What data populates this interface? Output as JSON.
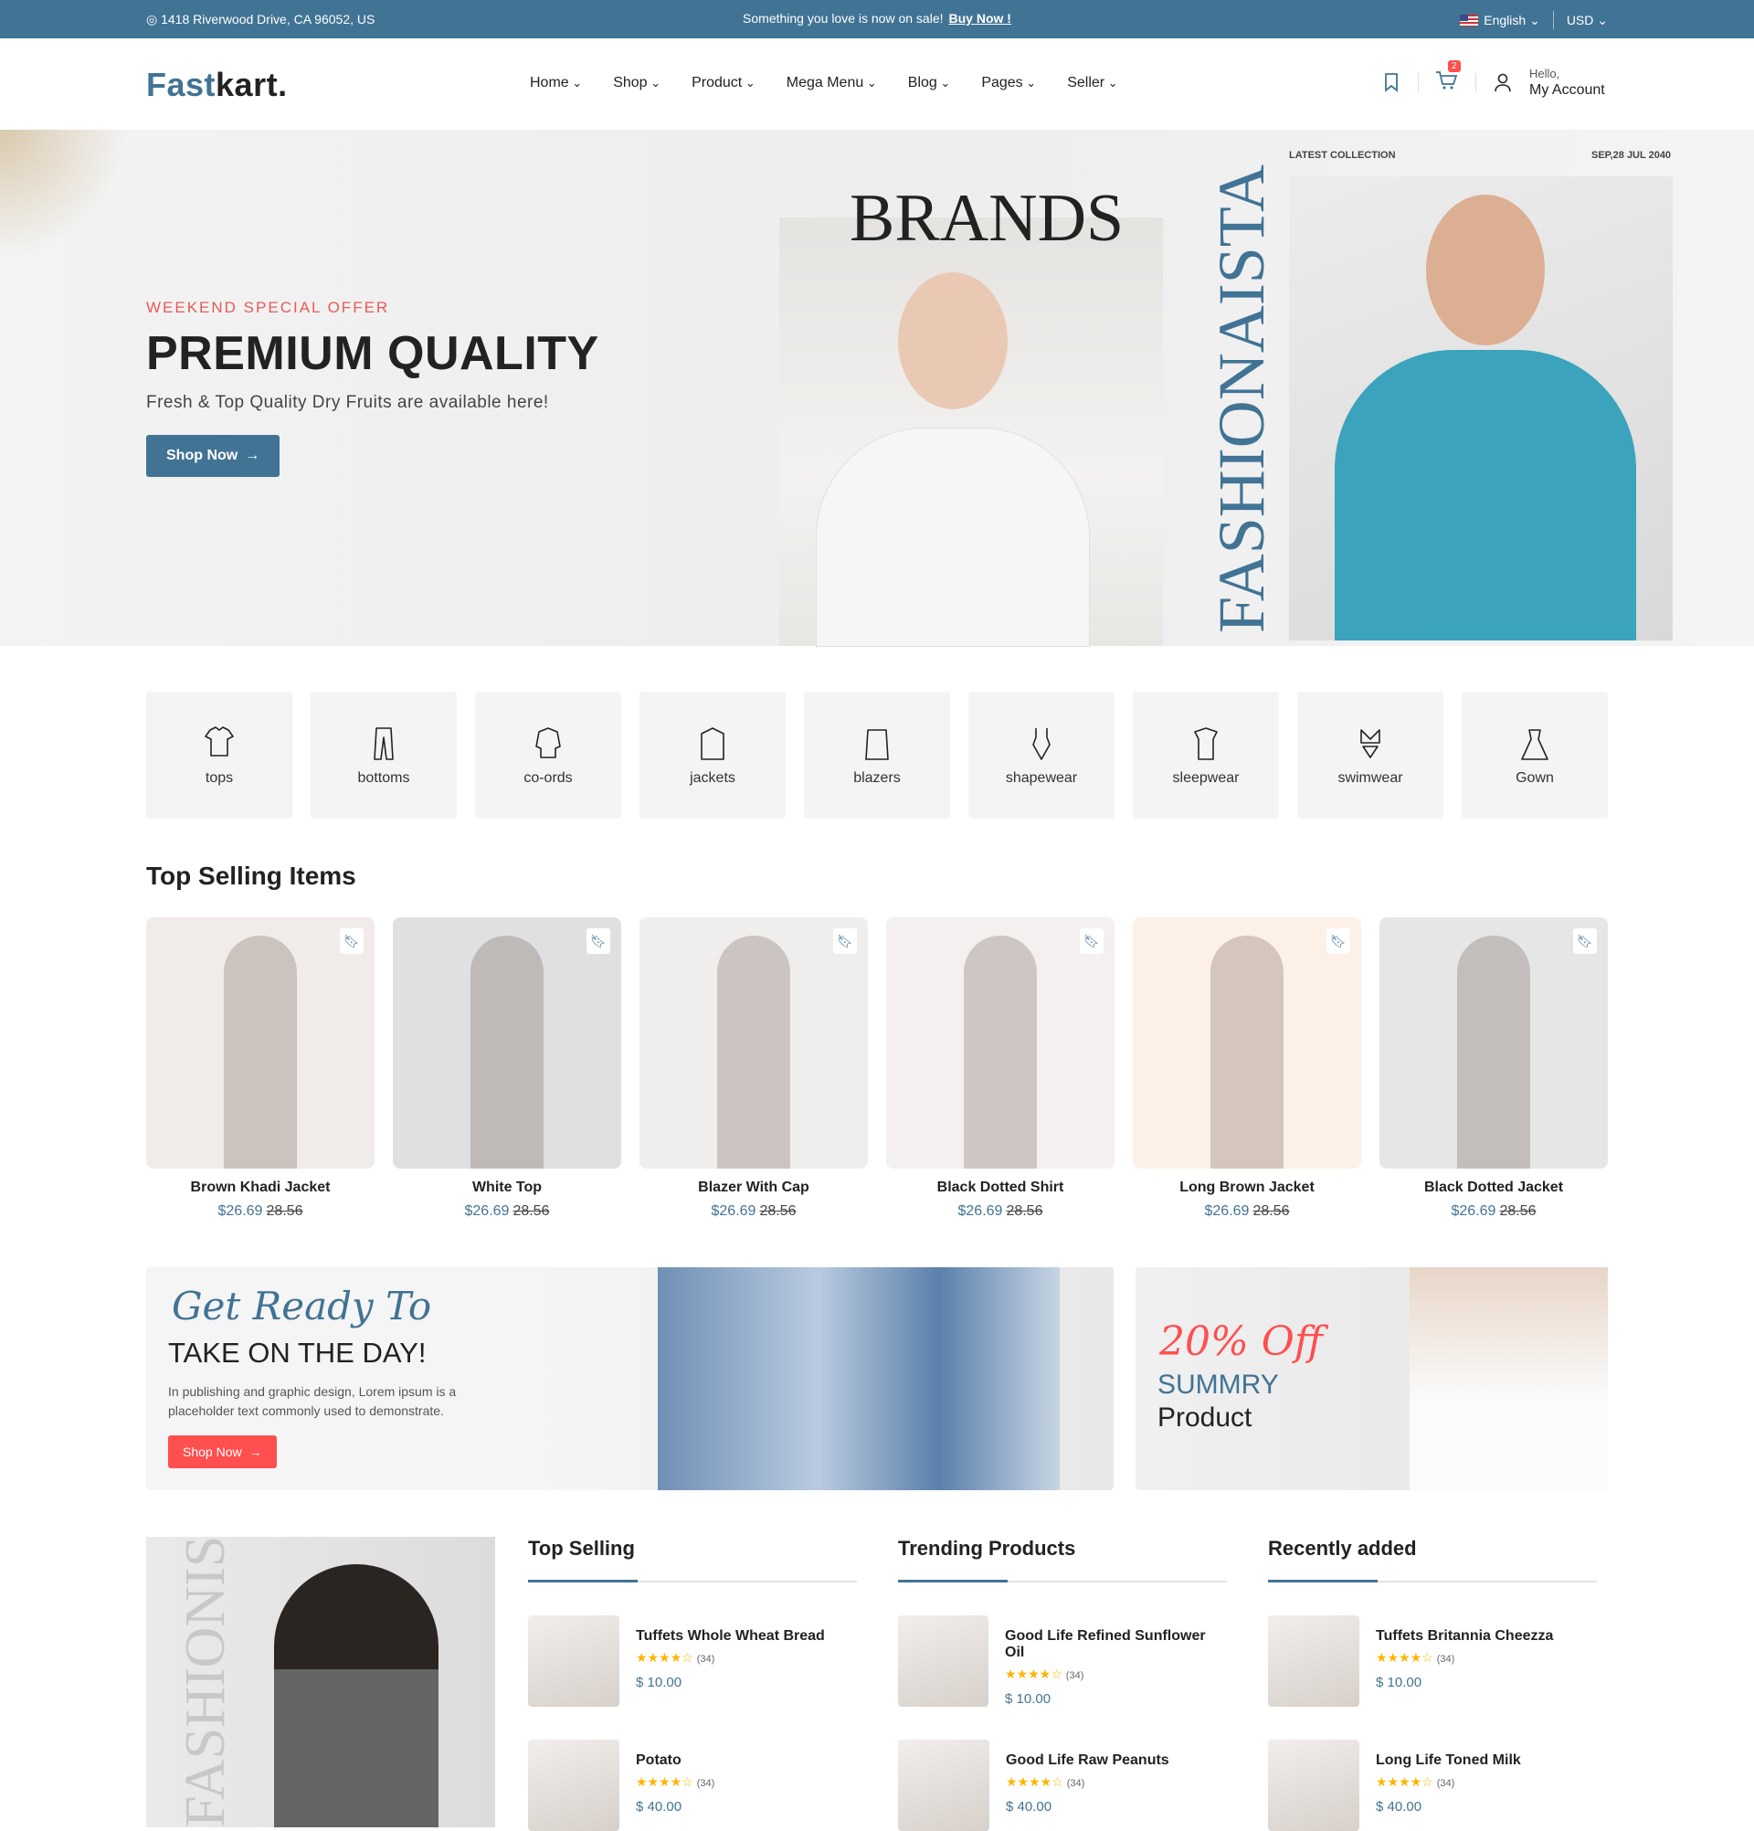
{
  "topbar": {
    "address": "1418 Riverwood Drive, CA 96052, US",
    "promo": "Something you love is now on sale!",
    "promo_link": "Buy Now !",
    "language": "English",
    "currency": "USD"
  },
  "header": {
    "logo_a": "Fast",
    "logo_b": "kart.",
    "nav": [
      "Home",
      "Shop",
      "Product",
      "Mega Menu",
      "Blog",
      "Pages",
      "Seller"
    ],
    "cart_count": "2",
    "hello": "Hello,",
    "account": "My Account"
  },
  "hero": {
    "eyebrow": "WEEKEND SPECIAL OFFER",
    "title": "PREMIUM QUALITY",
    "subtitle": "Fresh & Top Quality Dry Fruits are available here!",
    "button": "Shop Now",
    "brands": "BRANDS",
    "vertical": "FASHIONAISTA",
    "latest": "LATEST COLLECTION",
    "date": "SEP,28 JUL 2040"
  },
  "categories": [
    "tops",
    "bottoms",
    "co-ords",
    "jackets",
    "blazers",
    "shapewear",
    "sleepwear",
    "swimwear",
    "Gown"
  ],
  "top_selling_items": {
    "title": "Top Selling Items",
    "products": [
      {
        "name": "Brown Khadi Jacket",
        "price": "$26.69",
        "old": "28.56"
      },
      {
        "name": "White Top",
        "price": "$26.69",
        "old": "28.56"
      },
      {
        "name": "Blazer With Cap",
        "price": "$26.69",
        "old": "28.56"
      },
      {
        "name": "Black Dotted Shirt",
        "price": "$26.69",
        "old": "28.56"
      },
      {
        "name": "Long Brown Jacket",
        "price": "$26.69",
        "old": "28.56"
      },
      {
        "name": "Black Dotted Jacket",
        "price": "$26.69",
        "old": "28.56"
      }
    ]
  },
  "banner1": {
    "script": "Get Ready To",
    "title": "TAKE ON THE DAY!",
    "text": "In publishing and graphic design, Lorem ipsum is a placeholder text commonly used to demonstrate.",
    "button": "Shop Now"
  },
  "banner2": {
    "offer": "20% Off",
    "line1": "SUMMRY",
    "line2": "Product"
  },
  "side_banner": {
    "vertical": "FASHIONIS"
  },
  "columns": [
    {
      "title": "Top Selling",
      "items": [
        {
          "name": "Tuffets Whole Wheat Bread",
          "reviews": "(34)",
          "price": "$ 10.00"
        },
        {
          "name": "Potato",
          "reviews": "(34)",
          "price": "$ 40.00"
        }
      ]
    },
    {
      "title": "Trending Products",
      "items": [
        {
          "name": "Good Life Refined Sunflower Oil",
          "reviews": "(34)",
          "price": "$ 10.00"
        },
        {
          "name": "Good Life Raw Peanuts",
          "reviews": "(34)",
          "price": "$ 40.00"
        }
      ]
    },
    {
      "title": "Recently added",
      "items": [
        {
          "name": "Tuffets Britannia Cheezza",
          "reviews": "(34)",
          "price": "$ 10.00"
        },
        {
          "name": "Long Life Toned Milk",
          "reviews": "(34)",
          "price": "$ 40.00"
        }
      ]
    }
  ],
  "colors": {
    "primary": "#417394",
    "accent": "#ff4f4f",
    "star": "#ffb400"
  }
}
